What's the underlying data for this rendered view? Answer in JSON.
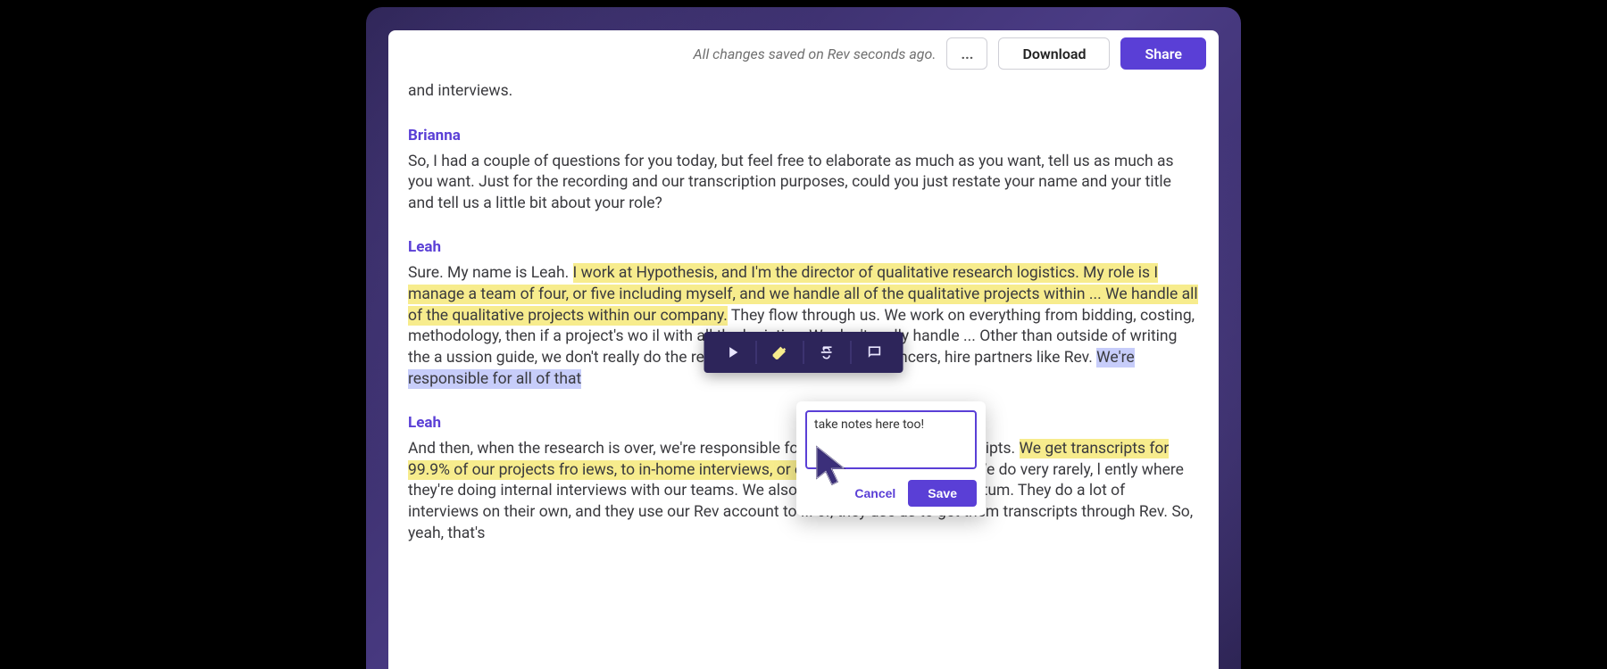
{
  "toolbar": {
    "save_status": "All changes saved on Rev seconds ago.",
    "more_label": "...",
    "download_label": "Download",
    "share_label": "Share"
  },
  "transcript": {
    "lead_trail": "and interviews.",
    "s1_name": "Brianna",
    "s1_text": "So, I had a couple of questions for you today, but feel free to elaborate as much as you want, tell us as much as you want. Just for the recording and our transcription purposes, could you just restate your name and your title and tell us a little bit about your role?",
    "s2_name": "Leah",
    "s2_pre": "Sure. My name is Leah. ",
    "s2_hl1": "I work at Hypothesis, and I'm the director of qualitative research logistics. My role is I manage a team of four, or five including myself, and we handle all of the qualitative projects within ... We handle all of the qualitative projects within our company.",
    "s2_mid": " They flow through us. We work on everything from bidding, costing, methodology, then if a project's wo                                         il with all the logistics. We don't really handle ... Other than outside of writing the a                                           ussion guide, we don't really do the research, but we do hire freelancers, hire partners like Rev. ",
    "s2_hl2": "We're responsible for all of that ",
    "s3_name": "Leah",
    "s3_pre": "And then, when the research is over, we're responsible for i                                         invoicing, getting transcripts. ",
    "s3_hl1": "We get transcripts for 99.9% of our projects fro                                          iews, to in-home interviews, or even sometimes internal.",
    "s3_post": " We do very rarely, l                                           ently where they're doing internal interviews with our teams. We also have another arm, Momentum. They do a lot of interviews on their own, and they use our Rev account to ... or, they use us to get them transcripts through Rev. So, yeah, that's"
  },
  "float_toolbar": {
    "play_icon": "play",
    "highlight_icon": "highlight",
    "strike_icon": "strikethrough",
    "comment_icon": "comment"
  },
  "note": {
    "value": "take notes here too!",
    "cancel_label": "Cancel",
    "save_label": "Save"
  },
  "colors": {
    "accent": "#5a3fd6",
    "highlight_yellow": "#f7ec8d",
    "highlight_blue": "#c7cdfa",
    "toolbar_bg": "#2d255a"
  }
}
